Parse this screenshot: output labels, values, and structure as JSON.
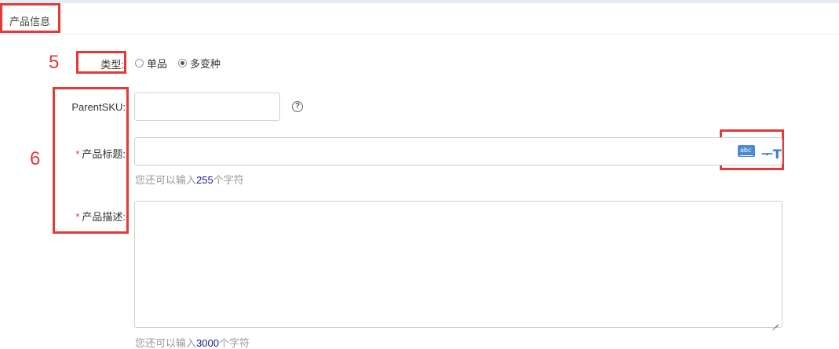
{
  "section": {
    "title": "产品信息"
  },
  "annotations": {
    "a5": "5",
    "a6": "6"
  },
  "type_field": {
    "label": "类型:",
    "options": [
      {
        "label": "单品",
        "checked": false
      },
      {
        "label": "多变种",
        "checked": true
      }
    ]
  },
  "parent_sku": {
    "label": "ParentSKU:",
    "value": "",
    "help_icon": "?"
  },
  "product_title": {
    "required_mark": "*",
    "label": "产品标题:",
    "value": "",
    "hint_prefix": "您还可以输入",
    "hint_count": "255",
    "hint_suffix": "个字符",
    "icons": [
      "keyboard-icon",
      "font-size-icon"
    ],
    "font_icon_glyph": "ᅮT"
  },
  "product_desc": {
    "required_mark": "*",
    "label": "产品描述:",
    "value": "",
    "hint_prefix": "您还可以输入",
    "hint_count": "3000",
    "hint_suffix": "个字符"
  },
  "colors": {
    "annotation": "#e53935",
    "accent": "#3b78c8",
    "hint_number": "#1a1a8c"
  }
}
